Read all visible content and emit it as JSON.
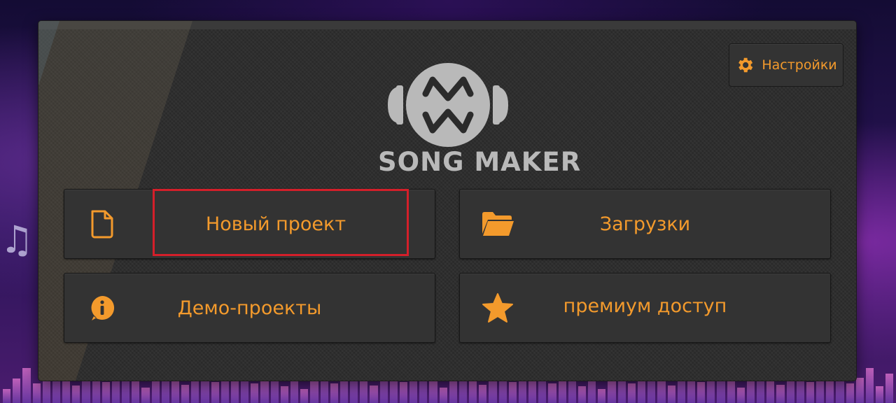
{
  "app": {
    "logo_text": "SONG MAKER",
    "logo_monogram": "MW"
  },
  "settings": {
    "label": "Настройки",
    "icon": "gear-icon"
  },
  "menu": {
    "new_project": {
      "label": "Новый проект",
      "icon": "document-icon"
    },
    "downloads": {
      "label": "Загрузки",
      "icon": "folder-icon"
    },
    "demo_projects": {
      "label": "Демо-проекты",
      "icon": "info-icon"
    },
    "premium": {
      "label": "премиум доступ",
      "icon": "star-icon"
    }
  },
  "colors": {
    "accent": "#f39a2c",
    "panel": "#2b2b2b",
    "button": "#333333",
    "logo": "#b9b9b9",
    "highlight": "#d41f2a"
  }
}
